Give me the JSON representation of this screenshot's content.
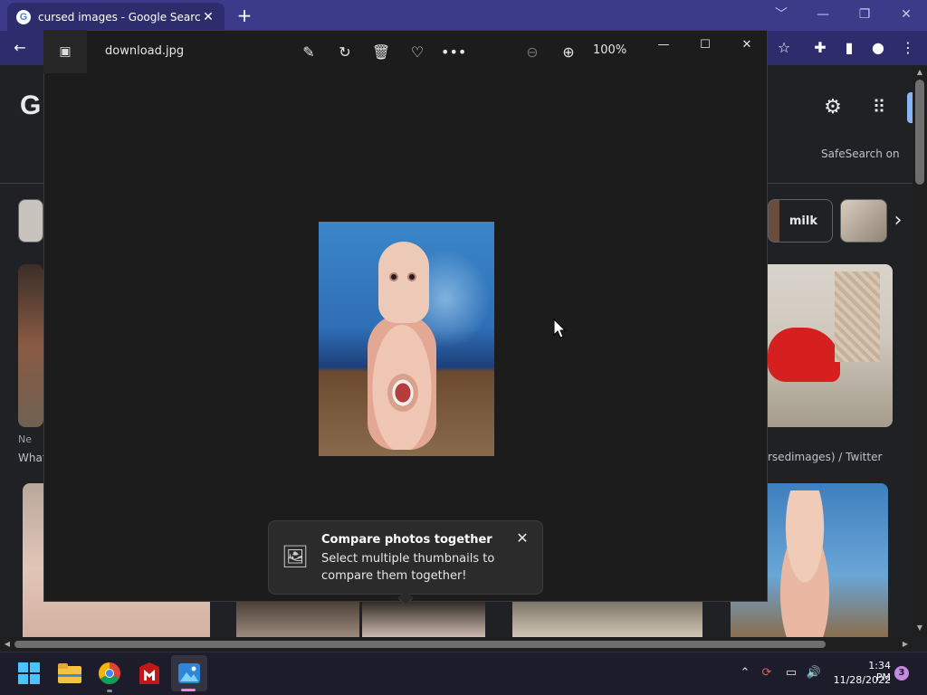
{
  "browser": {
    "tab_title": "cursed images - Google Search",
    "tab_close": "✕",
    "new_tab": "+",
    "favicon_letter": "G",
    "window_controls": [
      "﹀",
      "—",
      "❐",
      "✕"
    ]
  },
  "google": {
    "logo_letter": "G",
    "safesearch_label": "SafeSearch on",
    "chip_label": "milk",
    "left_caption_source": "Ne",
    "left_caption_title": "What",
    "right_caption": "rsedimages) / Twitter"
  },
  "viewer": {
    "filename": "download.jpg",
    "zoom_level": "100%",
    "tools": [
      "edit-image",
      "rotate",
      "delete",
      "favorite",
      "more"
    ],
    "toast": {
      "title": "Compare photos together",
      "body": "Select multiple thumbnails to compare them together!"
    }
  },
  "taskbar": {
    "time": "1:34 PM",
    "date": "11/28/2022",
    "notification_count": "3"
  },
  "colors": {
    "chrome_frame": "#3b3b8a",
    "chrome_toolbar": "#2d2d6e",
    "viewer_bg": "#1c1c1c",
    "taskbar": "#1c1c2b",
    "badge": "#c489e0"
  }
}
